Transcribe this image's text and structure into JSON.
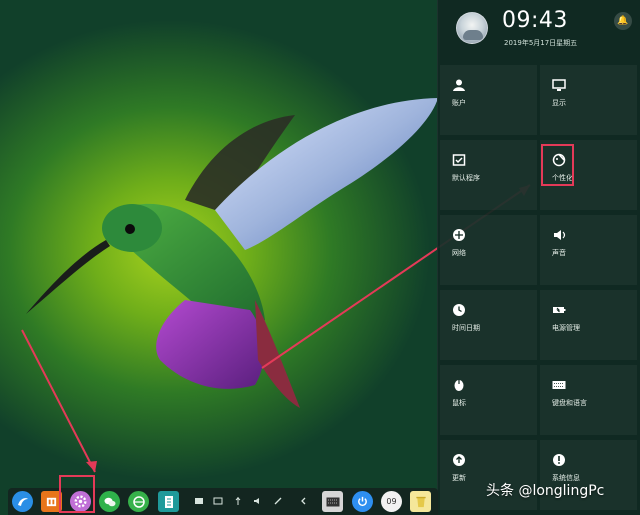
{
  "control_center": {
    "clock": {
      "time": "09:43",
      "date": "2019年5月17日星期五"
    },
    "tiles": [
      {
        "label": "账户",
        "icon": "user-icon"
      },
      {
        "label": "显示",
        "icon": "monitor-icon"
      },
      {
        "label": "默认程序",
        "icon": "default-apps-icon"
      },
      {
        "label": "个性化",
        "icon": "palette-icon"
      },
      {
        "label": "网络",
        "icon": "network-icon"
      },
      {
        "label": "声音",
        "icon": "speaker-icon"
      },
      {
        "label": "时间日期",
        "icon": "clock-icon"
      },
      {
        "label": "电源管理",
        "icon": "battery-icon"
      },
      {
        "label": "鼠标",
        "icon": "mouse-icon"
      },
      {
        "label": "键盘和语言",
        "icon": "keyboard-icon"
      },
      {
        "label": "更新",
        "icon": "update-icon"
      },
      {
        "label": "系统信息",
        "icon": "info-icon"
      }
    ]
  },
  "dock": {
    "apps": [
      {
        "name": "launcher-icon",
        "color": "#2a8ee6"
      },
      {
        "name": "app-store-icon",
        "color": "#e8751a"
      },
      {
        "name": "control-center-icon",
        "color": "#c06fd6"
      },
      {
        "name": "wechat-icon",
        "color": "#2fb24b"
      },
      {
        "name": "browser-icon",
        "color": "#36b14a"
      },
      {
        "name": "file-icon",
        "color": "#1f9a9a"
      }
    ],
    "right_apps": [
      {
        "name": "onboard-keyboard-icon",
        "color": "#d6d6d6"
      },
      {
        "name": "power-icon",
        "color": "#2e8ff0"
      },
      {
        "name": "clock-widget-icon",
        "color": "#f2f2f2"
      },
      {
        "name": "trash-icon",
        "color": "#f5e79a"
      }
    ],
    "clock_widget_label": "09"
  },
  "watermark": "头条 @longlingPc",
  "colors": {
    "highlight": "#e43a58",
    "panel": "#102821"
  }
}
